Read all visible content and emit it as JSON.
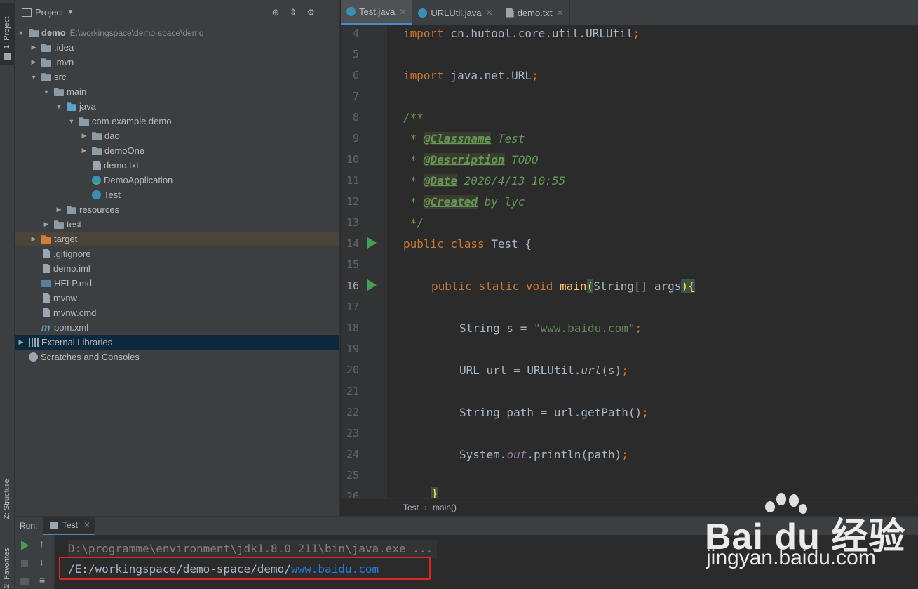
{
  "left_strip": {
    "project_tab": "1: Project",
    "structure_tab": "Z: Structure",
    "favorites_tab": "2: Favorites"
  },
  "project": {
    "title": "Project",
    "tree": [
      {
        "label": "demo",
        "extra": "E:\\workingspace\\demo-space\\demo",
        "depth": 0,
        "arrow": "open",
        "icon": "folder-icon"
      },
      {
        "label": ".idea",
        "depth": 1,
        "arrow": "closed",
        "icon": "folder-icon"
      },
      {
        "label": ".mvn",
        "depth": 1,
        "arrow": "closed",
        "icon": "folder-icon"
      },
      {
        "label": "src",
        "depth": 1,
        "arrow": "open",
        "icon": "folder-icon"
      },
      {
        "label": "main",
        "depth": 2,
        "arrow": "open",
        "icon": "folder-icon"
      },
      {
        "label": "java",
        "depth": 3,
        "arrow": "open",
        "icon": "source-folder-icon"
      },
      {
        "label": "com.example.demo",
        "depth": 4,
        "arrow": "open",
        "icon": "package-icon"
      },
      {
        "label": "dao",
        "depth": 5,
        "arrow": "closed",
        "icon": "package-icon"
      },
      {
        "label": "demoOne",
        "depth": 5,
        "arrow": "closed",
        "icon": "package-icon"
      },
      {
        "label": "demo.txt",
        "depth": 5,
        "arrow": "none",
        "icon": "text-file-icon"
      },
      {
        "label": "DemoApplication",
        "depth": 5,
        "arrow": "none",
        "icon": "spring-class-icon"
      },
      {
        "label": "Test",
        "depth": 5,
        "arrow": "none",
        "icon": "class-icon"
      },
      {
        "label": "resources",
        "depth": 3,
        "arrow": "closed",
        "icon": "resources-folder-icon"
      },
      {
        "label": "test",
        "depth": 2,
        "arrow": "closed",
        "icon": "folder-icon"
      },
      {
        "label": "target",
        "depth": 1,
        "arrow": "closed",
        "icon": "excluded-folder-icon"
      },
      {
        "label": ".gitignore",
        "depth": 1,
        "arrow": "none",
        "icon": "text-file-icon"
      },
      {
        "label": "demo.iml",
        "depth": 1,
        "arrow": "none",
        "icon": "module-file-icon"
      },
      {
        "label": "HELP.md",
        "depth": 1,
        "arrow": "none",
        "icon": "markdown-file-icon"
      },
      {
        "label": "mvnw",
        "depth": 1,
        "arrow": "none",
        "icon": "text-file-icon"
      },
      {
        "label": "mvnw.cmd",
        "depth": 1,
        "arrow": "none",
        "icon": "text-file-icon"
      },
      {
        "label": "pom.xml",
        "depth": 1,
        "arrow": "none",
        "icon": "maven-icon"
      },
      {
        "label": "External Libraries",
        "depth": 0,
        "arrow": "closed",
        "icon": "libraries-icon"
      },
      {
        "label": "Scratches and Consoles",
        "depth": 0,
        "arrow": "none",
        "icon": "scratches-icon"
      }
    ]
  },
  "editor": {
    "tabs": [
      {
        "label": "Test.java",
        "active": true,
        "icon": "class-icon"
      },
      {
        "label": "URLUtil.java",
        "active": false,
        "icon": "class-icon"
      },
      {
        "label": "demo.txt",
        "active": false,
        "icon": "text-file-icon"
      }
    ],
    "line_numbers": [
      "4",
      "5",
      "6",
      "7",
      "8",
      "9",
      "10",
      "11",
      "12",
      "13",
      "14",
      "15",
      "16",
      "17",
      "18",
      "19",
      "20",
      "21",
      "22",
      "23",
      "24",
      "25",
      "26"
    ],
    "code": {
      "l4_kw": "import",
      "l4_rest": " cn.hutool.core.util.URLUtil",
      "l6_kw": "import",
      "l6_rest": " java.net.URL",
      "semi": ";",
      "l8": "/**",
      "l9_pre": " * ",
      "l9_tag": "@Classname",
      "l9_rest": " Test",
      "l10_tag": "@Description",
      "l10_rest": " TODO",
      "l11_tag": "@Date",
      "l11_rest": " 2020/4/13 10:55",
      "l12_tag": "@Created",
      "l12_rest": " by lyc",
      "l13": " */",
      "l14_kw": "public class",
      "l14_rest": " Test {",
      "l16_kw": "public static void",
      "l16_fn": "main",
      "l16_open": "(",
      "l16_args": "String[] args",
      "l16_close": ")",
      "l16_brace": "{",
      "l18_pre": "String s = ",
      "l18_str": "\"www.baidu.com\"",
      "l20_pre": "URL url = URLUtil.",
      "l20_call": "url",
      "l20_post": "(s)",
      "l22_pre": "String path = url.getPath()",
      "l24_pre": "System.",
      "l24_field": "out",
      "l24_post": ".println(path)",
      "l26": "}"
    },
    "breadcrumb": [
      "Test",
      "main()"
    ]
  },
  "run": {
    "label": "Run:",
    "tab_label": "Test",
    "command_line": "D:\\programme\\environment\\jdk1.8.0_211\\bin\\java.exe ...",
    "output_prefix": "/E:/workingspace/demo-space/demo/",
    "output_link": "www.baidu.com"
  },
  "watermark": {
    "logo": "Bai  du 经验",
    "domain": "jingyan.baidu.com"
  },
  "colors": {
    "keyword": "#cc7832",
    "string": "#6a8759",
    "comment": "#629755",
    "link": "#287bde",
    "highlight_box": "#e62323",
    "accent": "#4a88c7"
  }
}
